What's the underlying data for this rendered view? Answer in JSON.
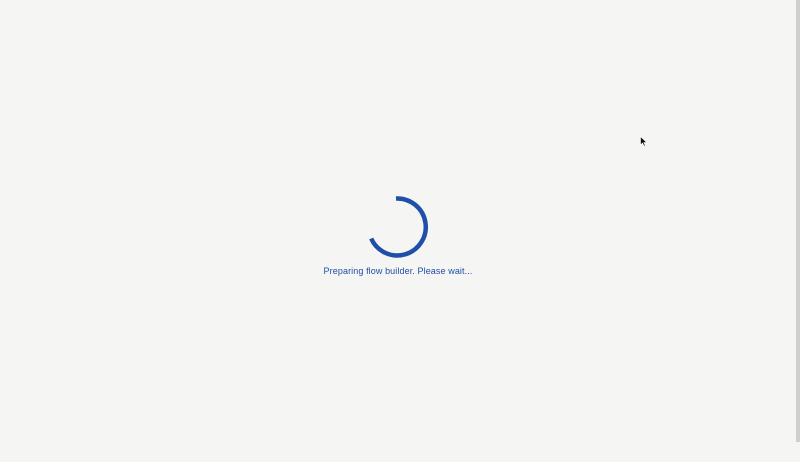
{
  "loading": {
    "message": "Preparing flow builder. Please wait...",
    "spinner_color": "#1f4fa8"
  },
  "icons": {
    "spinner": "loading-spinner-icon",
    "cursor": "mouse-pointer-icon"
  },
  "colors": {
    "background": "#f5f5f3",
    "accent": "#1f4fa8"
  }
}
